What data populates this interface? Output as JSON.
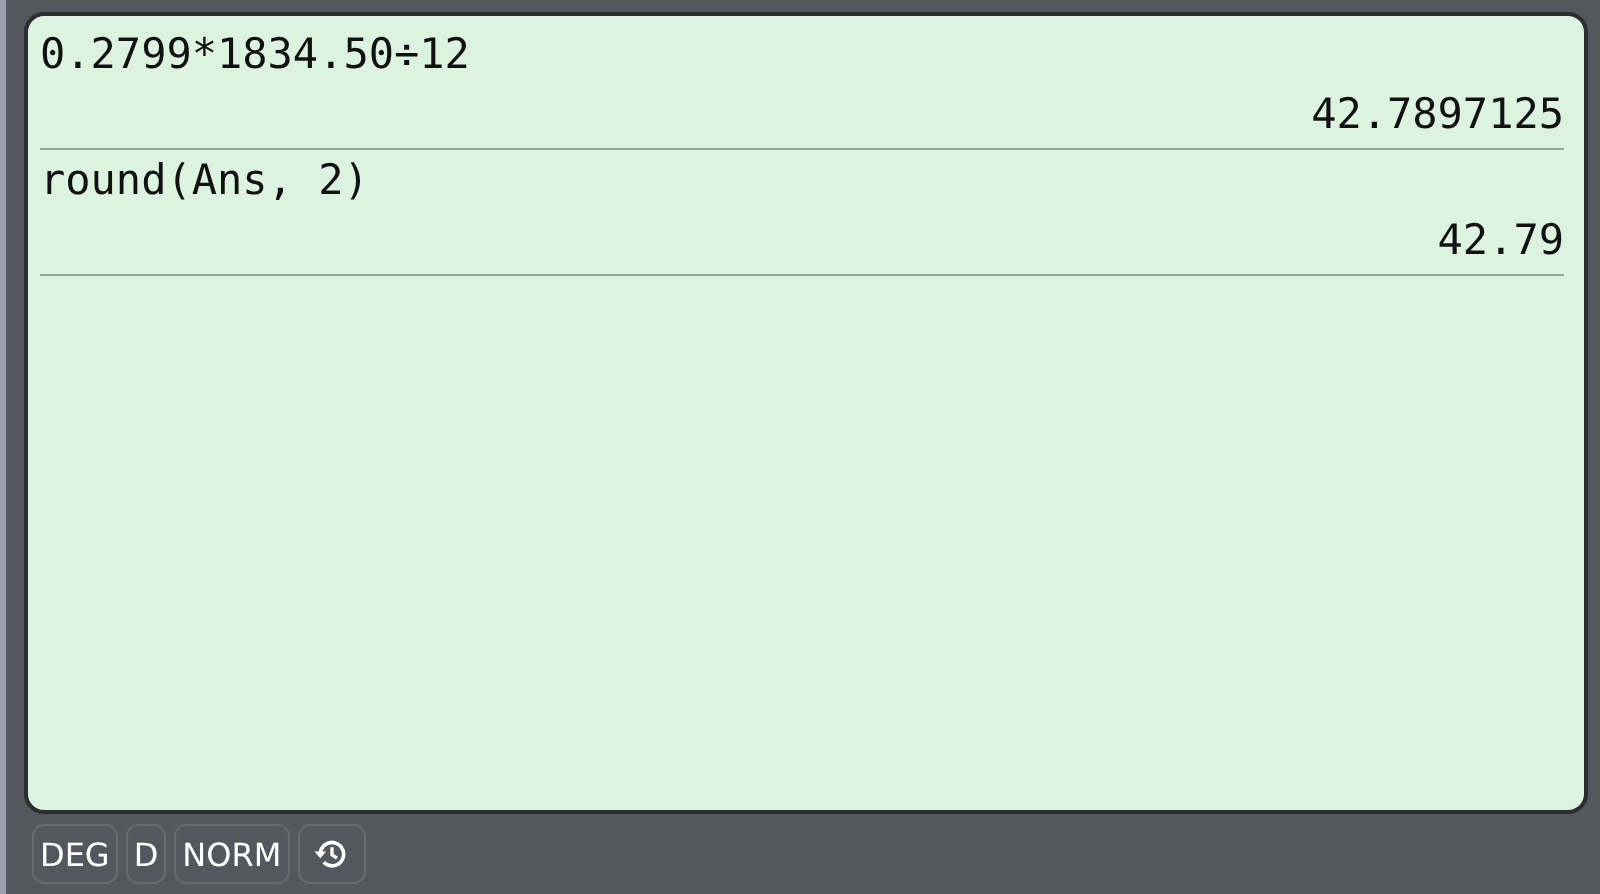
{
  "entries": [
    {
      "expression": "0.2799*1834.50÷12",
      "result": "42.7897125"
    },
    {
      "expression": "round(Ans, 2)",
      "result": "42.79"
    }
  ],
  "status_bar": {
    "buttons": [
      "DEG",
      "D",
      "NORM"
    ]
  }
}
